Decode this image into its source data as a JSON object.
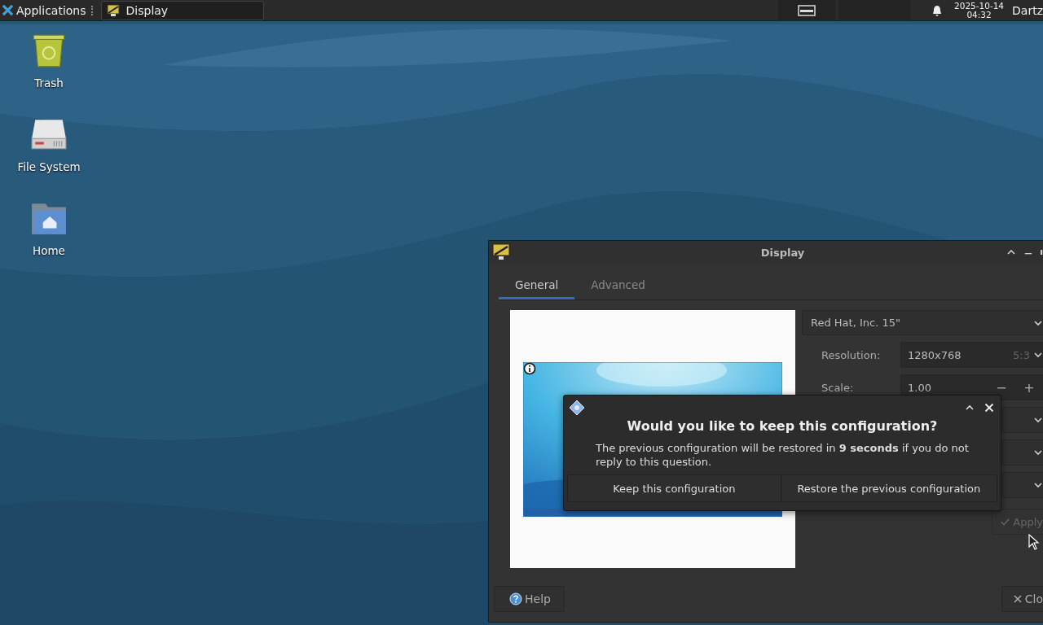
{
  "taskbar": {
    "menu_button": "Applications",
    "tasks": [
      {
        "label": "Display",
        "selected": true
      }
    ],
    "clock": {
      "date": "2025-10-14",
      "time": "04:32"
    },
    "user": "Dartz"
  },
  "desktop_icons": [
    {
      "label": "Trash",
      "kind": "trash"
    },
    {
      "label": "File System",
      "kind": "drive"
    },
    {
      "label": "Home",
      "kind": "home"
    }
  ],
  "window": {
    "title": "Display",
    "tabs": [
      {
        "label": "General",
        "selected": true
      },
      {
        "label": "Advanced",
        "selected": false
      }
    ],
    "display_select": "Red Hat, Inc. 15\"",
    "resolution": {
      "label": "Resolution:",
      "value": "1280x768",
      "aspect": "5:3"
    },
    "scale": {
      "label": "Scale:",
      "value": "1.00",
      "decrement": "−",
      "increment": "+"
    },
    "apply": {
      "label": "Apply",
      "disabled": true
    },
    "help": "Help",
    "close": "Clo"
  },
  "dialog": {
    "title": "Would you like to keep this configuration?",
    "message": "The previous configuration will be restored in **9 seconds** if you do not reply to this question.",
    "buttons": [
      "Keep this configuration",
      "Restore the previous configuration"
    ]
  }
}
